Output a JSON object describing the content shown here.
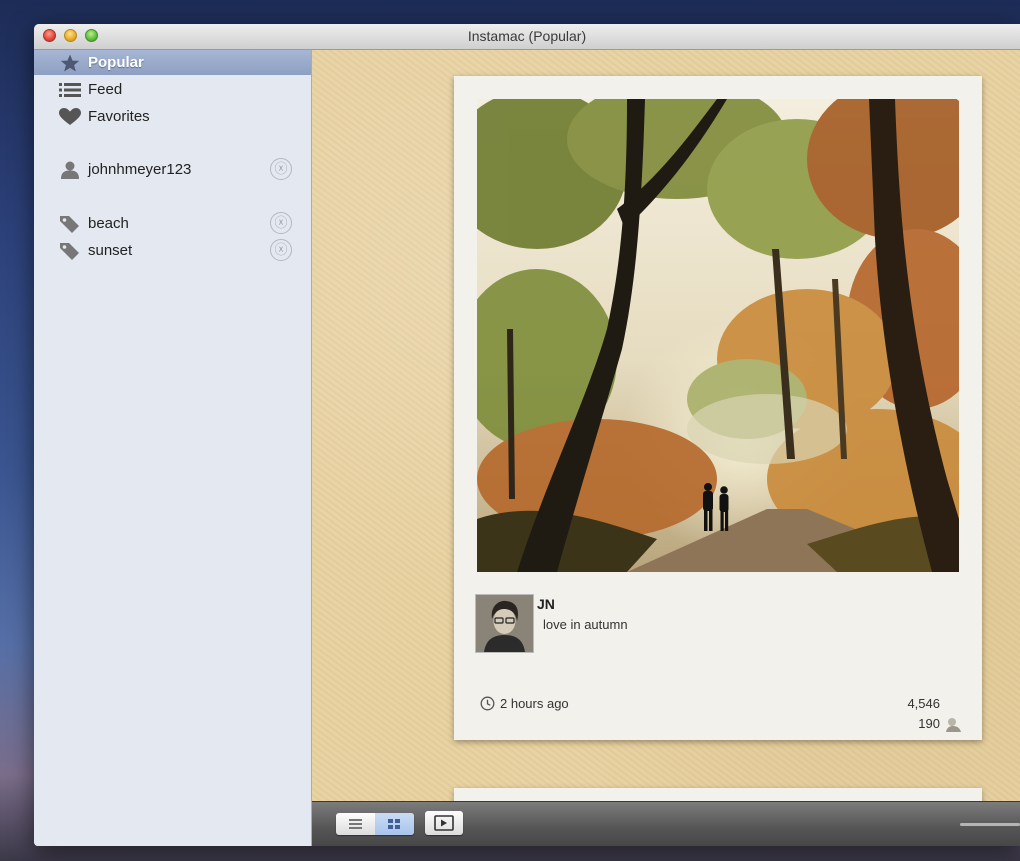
{
  "window": {
    "title": "Instamac (Popular)"
  },
  "sidebar": {
    "items": [
      {
        "label": "Popular",
        "icon": "star-icon",
        "selected": true
      },
      {
        "label": "Feed",
        "icon": "list-icon"
      },
      {
        "label": "Favorites",
        "icon": "heart-icon"
      }
    ],
    "users": [
      {
        "label": "johnhmeyer123",
        "icon": "person-icon"
      }
    ],
    "tags": [
      {
        "label": "beach",
        "icon": "tag-icon"
      },
      {
        "label": "sunset",
        "icon": "tag-icon"
      }
    ],
    "remove_symbol": "ⓧ"
  },
  "post": {
    "username": "JN",
    "caption": "love in autumn",
    "time": "2 hours ago",
    "likes": "4,546",
    "comments": "190"
  },
  "toolbar": {
    "view_modes": [
      "list-view-icon",
      "grid-view-icon"
    ],
    "active_view": "grid-view-icon",
    "slideshow_icon": "play-icon"
  },
  "colors": {
    "selection": "#8d9fc2",
    "sidebar_bg": "#e4e9f1",
    "paper_bg": "#e7d1a0"
  }
}
